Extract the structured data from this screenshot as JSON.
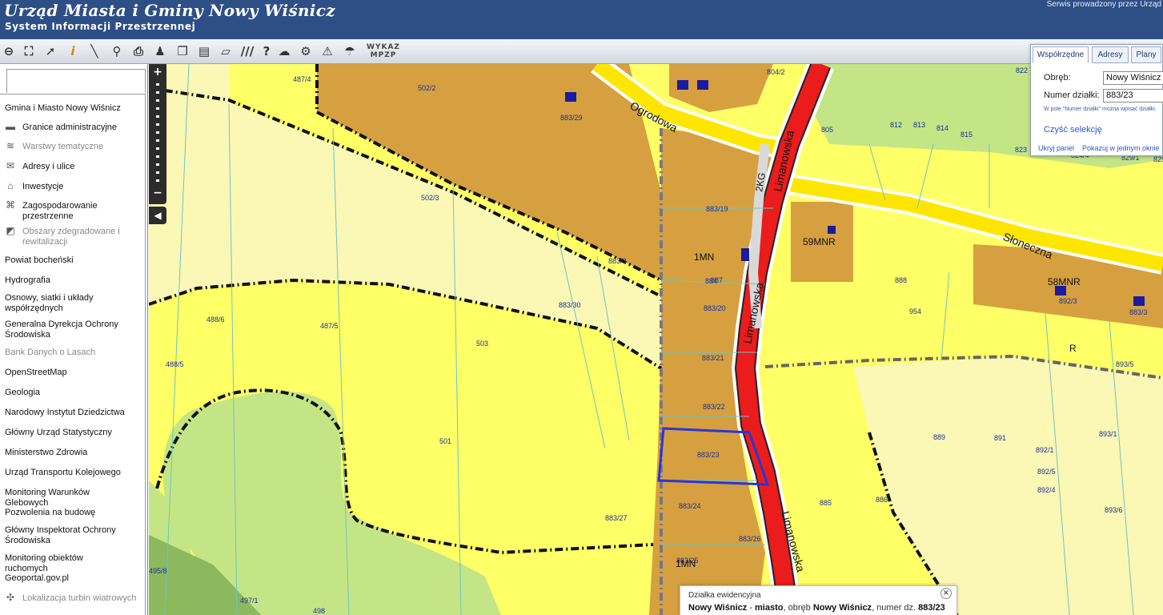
{
  "header": {
    "title": "Urząd Miasta i Gminy Nowy Wiśnicz",
    "subtitle": "System Informacji Przestrzennej",
    "service": "Serwis prowadzony przez Urząd"
  },
  "toolbar": {
    "tools": [
      "zoom-out-icon",
      "zoom-extent-icon",
      "pointer-icon",
      "info-icon",
      "measure-line-icon",
      "measure-area-icon",
      "print-icon",
      "street-view-icon",
      "copy-icon",
      "layout-icon",
      "comment-icon",
      "hatch-icon",
      "help-icon",
      "cloud-icon",
      "settings-icon",
      "warning-icon",
      "chat-icon"
    ],
    "wykaz_label": "WYKAZ MPZP"
  },
  "layers": [
    {
      "label": "Gmina i Miasto Nowy Wiśnicz",
      "icon": "",
      "dim": false
    },
    {
      "label": "Granice administracyjne",
      "icon": "boundary-icon",
      "dim": false
    },
    {
      "label": "Warstwy tematyczne",
      "icon": "layers-icon",
      "dim": true
    },
    {
      "label": "Adresy i ulice",
      "icon": "envelope-icon",
      "dim": false
    },
    {
      "label": "Inwestycje",
      "icon": "investment-icon",
      "dim": false
    },
    {
      "label": "Zagospodarowanie przestrzenne",
      "icon": "planning-icon",
      "dim": false
    },
    {
      "label": "Obszary zdegradowane i rewitalizacji",
      "icon": "degraded-area-icon",
      "dim": true
    },
    {
      "label": "Powiat bocheński",
      "icon": "",
      "dim": false
    },
    {
      "label": "Hydrografia",
      "icon": "",
      "dim": false
    },
    {
      "label": "Osnowy, siatki i układy współrzędnych",
      "icon": "",
      "dim": false
    },
    {
      "label": "Generalna Dyrekcja Ochrony Środowiska",
      "icon": "",
      "dim": false
    },
    {
      "label": "Bank Danych o Lasach",
      "icon": "",
      "dim": true
    },
    {
      "label": "OpenStreetMap",
      "icon": "",
      "dim": false
    },
    {
      "label": "Geologia",
      "icon": "",
      "dim": false
    },
    {
      "label": "Narodowy Instytut Dziedzictwa",
      "icon": "",
      "dim": false
    },
    {
      "label": "Główny Urząd Statystyczny",
      "icon": "",
      "dim": false
    },
    {
      "label": "Ministerstwo Zdrowia",
      "icon": "",
      "dim": false
    },
    {
      "label": "Urząd Transportu Kolejowego",
      "icon": "",
      "dim": false
    },
    {
      "label": "Monitoring Warunków Glebowych",
      "icon": "",
      "dim": false
    },
    {
      "label": "Pozwolenia na budowę",
      "icon": "",
      "dim": false
    },
    {
      "label": "Główny Inspektorat Ochrony Środowiska",
      "icon": "",
      "dim": false
    },
    {
      "label": "Monitoring obiektów ruchomych",
      "icon": "",
      "dim": false
    },
    {
      "label": "Geoportal.gov.pl",
      "icon": "",
      "dim": false
    },
    {
      "label": "Lokalizacja turbin wiatrowych",
      "icon": "wind-turbine-icon",
      "dim": true
    }
  ],
  "zoom": {
    "plus": "+",
    "minus": "−",
    "collapse": "◀"
  },
  "search_panel": {
    "tabs": [
      "Współrzędne",
      "Adresy",
      "Plany"
    ],
    "obreb_label": "Obręb:",
    "obreb_value": "Nowy Wiśnicz",
    "dzialka_label": "Numer działki:",
    "dzialka_value": "883/23",
    "hint": "W pole \"Numer działki\" można wpisać działki.",
    "clear": "Czyść selekcję",
    "hide": "Ukryj panel",
    "show_one": "Pokazuj w jednym oknie"
  },
  "map": {
    "parcels": [
      "487/4",
      "502/2",
      "883/29",
      "804/2",
      "805",
      "812",
      "813",
      "814",
      "815",
      "822",
      "823",
      "824/4",
      "829/1",
      "829/",
      "502/3",
      "883/19",
      "883/3",
      "883/30",
      "884",
      "887",
      "888",
      "892/3",
      "883/3",
      "488/6",
      "487/5",
      "503",
      "883/20",
      "954",
      "488/5",
      "883/21",
      "893/5",
      "883/22",
      "501",
      "889",
      "891",
      "893/1",
      "883/23",
      "892/1",
      "892/5",
      "892/4",
      "885",
      "886",
      "893/6",
      "883/24",
      "883/27",
      "883/26",
      "883/25",
      "495/8",
      "497/1",
      "498"
    ],
    "zones": [
      "1MN",
      "59MNR",
      "58MNR",
      "R",
      "1MN",
      "2KG"
    ],
    "roads": [
      "Ogrodowa",
      "Limanowska",
      "Limanowska",
      "Limanowska",
      "Słoneczna"
    ],
    "colors": {
      "mn_zone": "#d6a040",
      "residential": "#ffff66",
      "light_yellow": "#fbf7b4",
      "green": "#c4e585",
      "dark_green": "#8cb85e",
      "red_road": "#ea1c1c",
      "selection": "#2a36d4"
    }
  },
  "popup": {
    "title": "Działka ewidencyjna",
    "obreb_name": "Nowy Wiśnicz",
    "sep1": " - ",
    "obreb_kind": "miasto",
    "mid": ", obręb ",
    "obreb_name2": "Nowy Wiśnicz",
    "mid2": ", numer dz. ",
    "number": "883/23",
    "close": "×"
  }
}
